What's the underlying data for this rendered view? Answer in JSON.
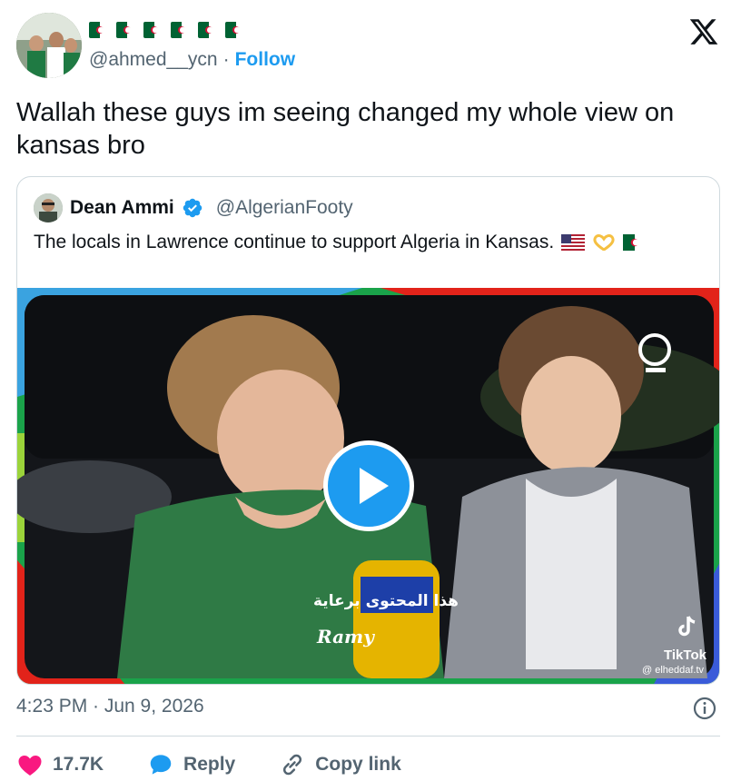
{
  "author": {
    "handle": "@ahmed__ycn",
    "separator": "·",
    "follow_label": "Follow",
    "display_name_flags": 6
  },
  "tweet": {
    "text": "Wallah these guys im seeing changed my whole view on kansas bro"
  },
  "quote": {
    "name": "Dean Ammi",
    "handle": "@AlgerianFooty",
    "text": "The locals in Lawrence continue to support Algeria in Kansas.",
    "media": {
      "overlay_arabic": "هذا المحتوى برعاية",
      "sponsor": "Ramy",
      "tiktok_label": "TikTok",
      "tiktok_handle": "@ elheddaf.tv"
    }
  },
  "meta": {
    "timestamp": "4:23 PM · Jun 9, 2026"
  },
  "actions": {
    "likes": "17.7K",
    "reply_label": "Reply",
    "copy_label": "Copy link"
  },
  "colors": {
    "accent": "#1d9bf0",
    "like": "#f91880",
    "muted": "#536471",
    "border": "#cfd9de"
  },
  "icons": [
    "x-logo-icon",
    "verified-badge-icon",
    "play-icon",
    "info-icon",
    "heart-icon",
    "reply-bubble-icon",
    "link-icon",
    "tiktok-icon"
  ]
}
